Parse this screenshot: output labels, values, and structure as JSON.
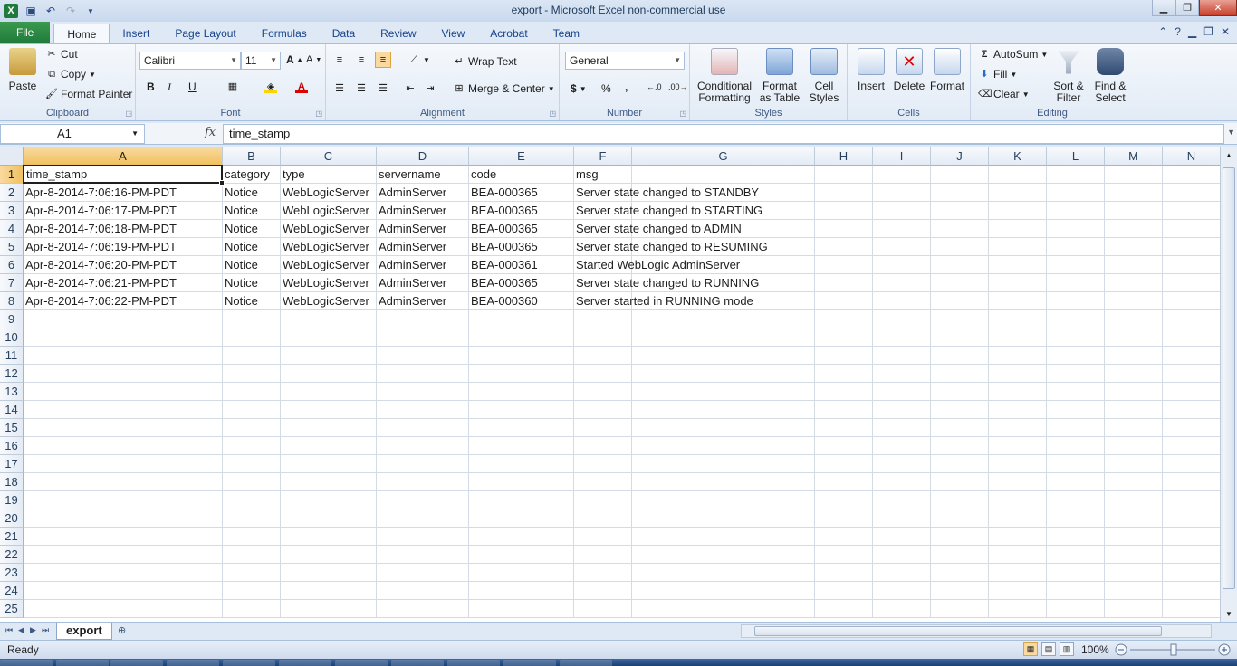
{
  "window": {
    "title": "export  -  Microsoft Excel non-commercial use",
    "controls": [
      "minimize",
      "restore",
      "close"
    ]
  },
  "ribbon_tabs": [
    "File",
    "Home",
    "Insert",
    "Page Layout",
    "Formulas",
    "Data",
    "Review",
    "View",
    "Acrobat",
    "Team"
  ],
  "active_tab": "Home",
  "ribbon": {
    "clipboard": {
      "paste": "Paste",
      "cut": "Cut",
      "copy": "Copy",
      "format_painter": "Format Painter",
      "label": "Clipboard"
    },
    "font": {
      "name": "Calibri",
      "size": "11",
      "label": "Font",
      "bold": "B",
      "italic": "I",
      "underline": "U"
    },
    "alignment": {
      "wrap_text": "Wrap Text",
      "merge_center": "Merge & Center",
      "label": "Alignment"
    },
    "number": {
      "format": "General",
      "label": "Number",
      "currency": "$",
      "percent": "%",
      "comma": ","
    },
    "styles": {
      "conditional_1": "Conditional",
      "conditional_2": "Formatting",
      "table_1": "Format",
      "table_2": "as Table",
      "cell_1": "Cell",
      "cell_2": "Styles",
      "label": "Styles"
    },
    "cells": {
      "insert": "Insert",
      "delete": "Delete",
      "format": "Format",
      "label": "Cells"
    },
    "editing": {
      "autosum": "AutoSum",
      "fill": "Fill",
      "clear": "Clear",
      "sort_1": "Sort &",
      "sort_2": "Filter",
      "find_1": "Find &",
      "find_2": "Select",
      "label": "Editing"
    }
  },
  "formula_bar": {
    "name_box": "A1",
    "fx": "fx",
    "content": "time_stamp"
  },
  "columns": [
    "A",
    "B",
    "C",
    "D",
    "E",
    "F",
    "G",
    "H",
    "I",
    "J",
    "K",
    "L",
    "M",
    "N"
  ],
  "rows": [
    "1",
    "2",
    "3",
    "4",
    "5",
    "6",
    "7",
    "8",
    "9",
    "10",
    "11",
    "12",
    "13",
    "14",
    "15",
    "16",
    "17",
    "18",
    "19",
    "20",
    "21",
    "22",
    "23",
    "24",
    "25"
  ],
  "cells": [
    [
      "time_stamp",
      "category",
      "type",
      "servername",
      "code",
      "msg"
    ],
    [
      "Apr-8-2014-7:06:16-PM-PDT",
      "Notice",
      "WebLogicServer",
      "AdminServer",
      "BEA-000365",
      "Server state changed to STANDBY"
    ],
    [
      "Apr-8-2014-7:06:17-PM-PDT",
      "Notice",
      "WebLogicServer",
      "AdminServer",
      "BEA-000365",
      "Server state changed to STARTING"
    ],
    [
      "Apr-8-2014-7:06:18-PM-PDT",
      "Notice",
      "WebLogicServer",
      "AdminServer",
      "BEA-000365",
      "Server state changed to ADMIN"
    ],
    [
      "Apr-8-2014-7:06:19-PM-PDT",
      "Notice",
      "WebLogicServer",
      "AdminServer",
      "BEA-000365",
      "Server state changed to RESUMING"
    ],
    [
      "Apr-8-2014-7:06:20-PM-PDT",
      "Notice",
      "WebLogicServer",
      "AdminServer",
      "BEA-000361",
      "Started WebLogic AdminServer"
    ],
    [
      "Apr-8-2014-7:06:21-PM-PDT",
      "Notice",
      "WebLogicServer",
      "AdminServer",
      "BEA-000365",
      "Server state changed to RUNNING"
    ],
    [
      "Apr-8-2014-7:06:22-PM-PDT",
      "Notice",
      "WebLogicServer",
      "AdminServer",
      "BEA-000360",
      "Server started in RUNNING mode"
    ]
  ],
  "sheets": [
    "export"
  ],
  "status": {
    "ready": "Ready",
    "zoom": "100%"
  },
  "colors": {
    "file_tab": "#1f7a3c",
    "selection_header": "#f1c15f",
    "ribbon": "#dfe9f5"
  }
}
